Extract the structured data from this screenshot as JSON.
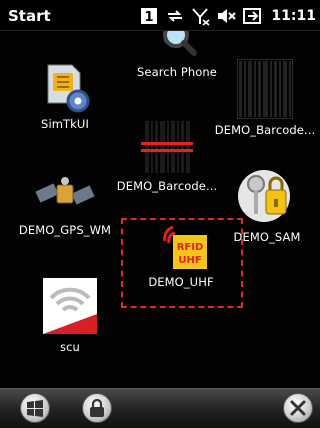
{
  "status_bar": {
    "title": "Start",
    "sim_badge": "1",
    "time": "11:11",
    "icons": [
      "sim-slot-icon",
      "data-transfer-icon",
      "no-signal-icon",
      "speaker-muted-icon",
      "battery-charging-icon"
    ]
  },
  "apps": [
    {
      "label": "Search Phone",
      "icon": "magnifier-phone-icon"
    },
    {
      "label": "SimTkUI",
      "icon": "sim-gear-icon"
    },
    {
      "label": "DEMO_Barcode...",
      "icon": "barcode-icon"
    },
    {
      "label": "DEMO_Barcode...",
      "icon": "barcode-laser-icon"
    },
    {
      "label": "DEMO_GPS_WM",
      "icon": "satellite-icon"
    },
    {
      "label": "DEMO_SAM",
      "icon": "keys-lock-icon"
    },
    {
      "label": "DEMO_UHF",
      "icon": "rfid-uhf-icon",
      "badge_line1": "RFID",
      "badge_line2": "UHF"
    },
    {
      "label": "scu",
      "icon": "wireless-card-icon"
    }
  ],
  "taskbar": {
    "buttons": [
      "windows-start-icon",
      "lock-icon",
      "close-icon"
    ]
  },
  "colors": {
    "selection": "#e3262b",
    "uhf_badge": "#f5c518"
  }
}
